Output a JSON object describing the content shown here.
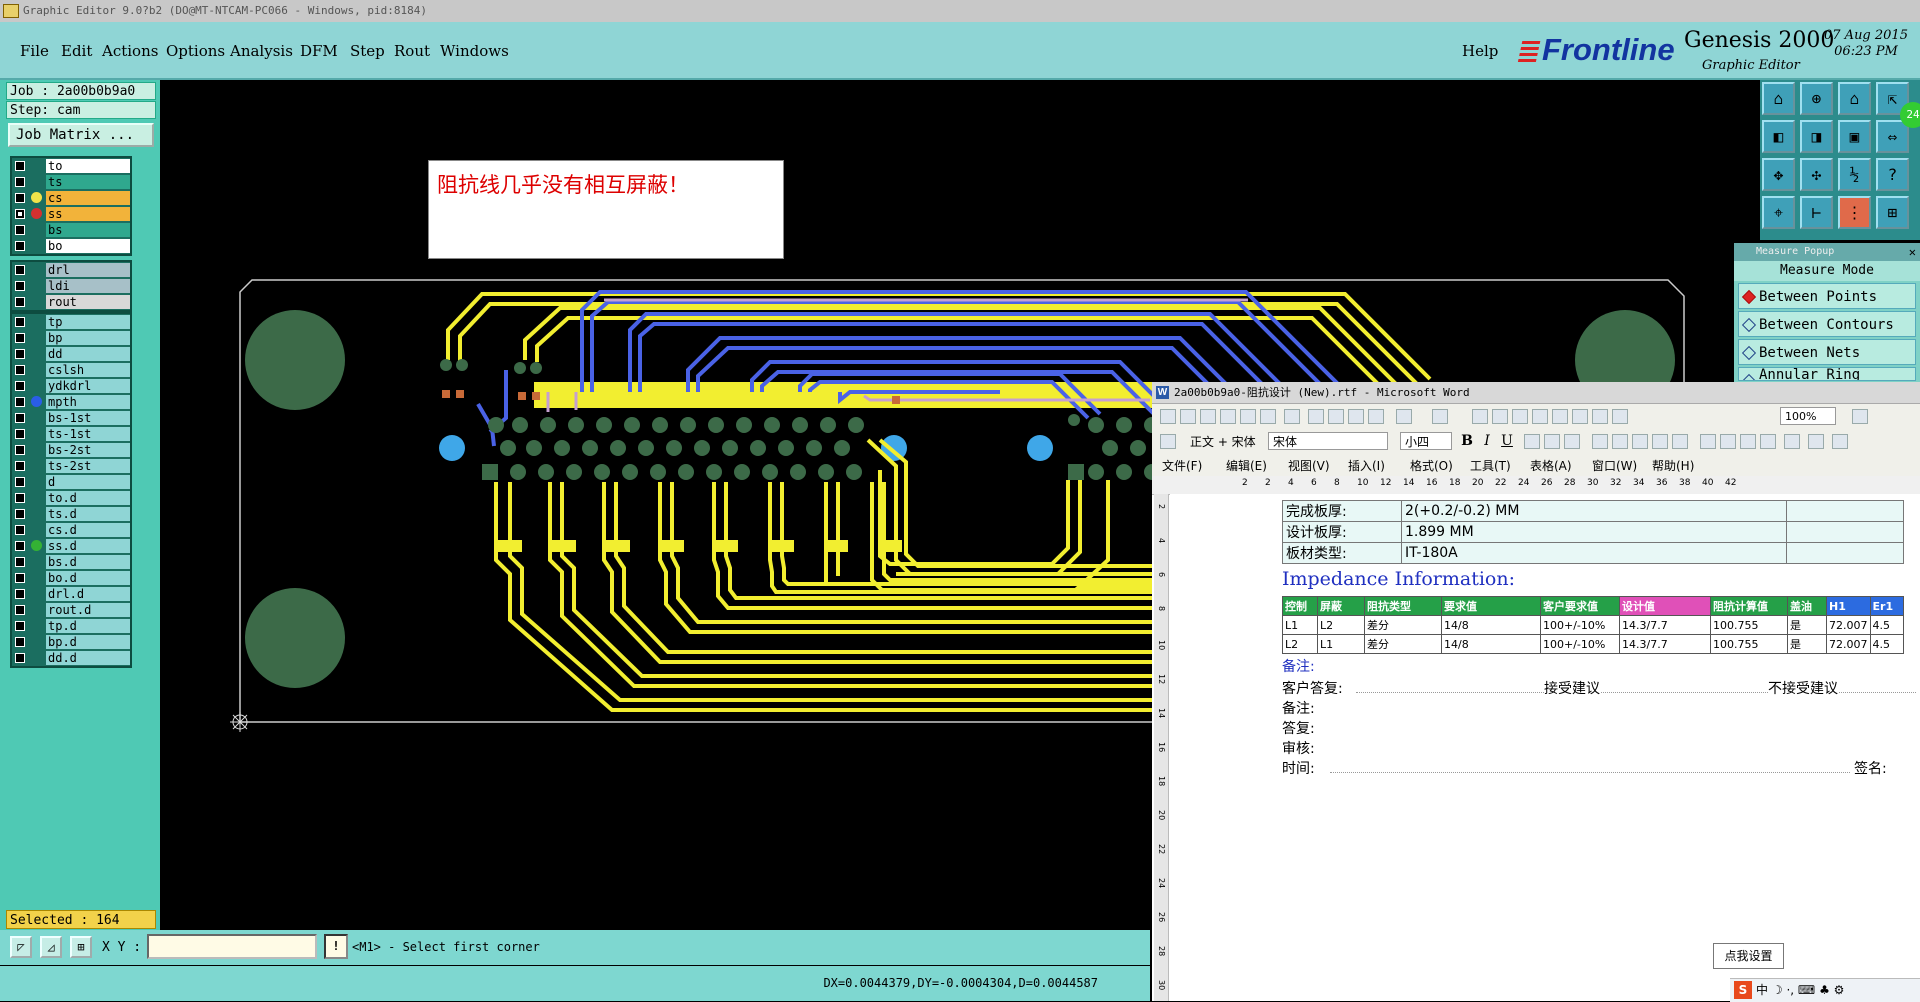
{
  "genesis": {
    "title_bar": "Graphic Editor 9.0?b2  (DO@MT-NTCAM-PC066 - Windows, pid:8184)",
    "menu": [
      "File",
      "Edit",
      "Actions",
      "Options",
      "Analysis",
      "DFM",
      "Step",
      "Rout",
      "Windows"
    ],
    "help": "Help",
    "logo": {
      "brand": "Frontline",
      "product": "Genesis 2000",
      "subtitle": "Graphic Editor",
      "date": "07 Aug 2015",
      "time": "06:23 PM"
    },
    "job": "Job : 2a00b0b9a0",
    "step": "Step: cam",
    "job_matrix": "Job Matrix ...",
    "layers_group1": [
      {
        "name": "to",
        "color": "#ffffff",
        "dot": ""
      },
      {
        "name": "ts",
        "color": "#2fa88e",
        "dot": ""
      },
      {
        "name": "cs",
        "color": "#f2b33a",
        "dot": "#f2e34a"
      },
      {
        "name": "ss",
        "color": "#f2b33a",
        "dot": "#d23030",
        "checked": true
      },
      {
        "name": "bs",
        "color": "#2fa88e",
        "dot": ""
      },
      {
        "name": "bo",
        "color": "#ffffff",
        "dot": ""
      }
    ],
    "layers_group2": [
      {
        "name": "drl",
        "color": "#a7c0c8"
      },
      {
        "name": "ldi",
        "color": "#a7c0c8"
      },
      {
        "name": "rout",
        "color": "#d8d8d8"
      }
    ],
    "layers_group3": [
      {
        "name": "tp",
        "dot": ""
      },
      {
        "name": "bp",
        "dot": ""
      },
      {
        "name": "dd",
        "dot": ""
      },
      {
        "name": "cslsh",
        "dot": ""
      },
      {
        "name": "ydkdrl",
        "dot": ""
      },
      {
        "name": "mpth",
        "dot": "#2a5de8"
      },
      {
        "name": "bs-1st",
        "dot": ""
      },
      {
        "name": "ts-1st",
        "dot": ""
      },
      {
        "name": "bs-2st",
        "dot": ""
      },
      {
        "name": "ts-2st",
        "dot": ""
      },
      {
        "name": "d",
        "dot": ""
      },
      {
        "name": "to.d",
        "dot": ""
      },
      {
        "name": "ts.d",
        "dot": ""
      },
      {
        "name": "cs.d",
        "dot": ""
      },
      {
        "name": "ss.d",
        "dot": "#34b234"
      },
      {
        "name": "bs.d",
        "dot": ""
      },
      {
        "name": "bo.d",
        "dot": ""
      },
      {
        "name": "drl.d",
        "dot": ""
      },
      {
        "name": "rout.d",
        "dot": ""
      },
      {
        "name": "tp.d",
        "dot": ""
      },
      {
        "name": "bp.d",
        "dot": ""
      },
      {
        "name": "dd.d",
        "dot": ""
      }
    ],
    "selected": "Selected : 164",
    "xy_label": "X Y :",
    "xy_value": "",
    "prompt": "<M1> - Select first corner",
    "measure_readout": "DX=0.0044379,DY=-0.0004304,D=0.0044587",
    "canvas_note": "阻抗线几乎没有相互屏蔽！",
    "measure_popup": {
      "title": "Measure Popup",
      "mode": "Measure Mode",
      "options": [
        "Between Points",
        "Between Contours",
        "Between Nets",
        "Annular Ring"
      ],
      "selected": "Between Points"
    },
    "tool_badge": "24"
  },
  "word": {
    "title": "2a00b0b9a0-阻抗设计 (New).rtf - Microsoft Word",
    "style": "正文 + 宋体",
    "font": "宋体",
    "size": "小四",
    "zoom": "100%",
    "menu": [
      "文件(F)",
      "编辑(E)",
      "视图(V)",
      "插入(I)",
      "格式(O)",
      "工具(T)",
      "表格(A)",
      "窗口(W)",
      "帮助(H)"
    ],
    "ruler": [
      "2",
      "2",
      "4",
      "6",
      "8",
      "10",
      "12",
      "14",
      "16",
      "18",
      "20",
      "22",
      "24",
      "26",
      "28",
      "30",
      "32",
      "34",
      "36",
      "38",
      "40",
      "42"
    ],
    "vruler": [
      "2",
      "4",
      "6",
      "8",
      "10",
      "12",
      "14",
      "16",
      "18",
      "20",
      "22",
      "24",
      "26",
      "28",
      "30"
    ],
    "board_rows": [
      {
        "label": "完成板厚:",
        "value": "2(+0.2/-0.2) MM"
      },
      {
        "label": "设计板厚:",
        "value": "1.899 MM"
      },
      {
        "label": "板材类型:",
        "value": "IT-180A"
      }
    ],
    "impedance_heading": "Impedance Information:",
    "imp_headers": [
      "控制",
      "屏蔽",
      "阻抗类型",
      "要求值",
      "客户要求值",
      "设计值",
      "阻抗计算值",
      "盖油",
      "H1",
      "Er1"
    ],
    "imp_rows": [
      [
        "L1",
        "L2",
        "差分",
        "14/8",
        "100+/-10%",
        "14.3/7.7",
        "100.755",
        "是",
        "72.007",
        "4.5"
      ],
      [
        "L2",
        "L1",
        "差分",
        "14/8",
        "100+/-10%",
        "14.3/7.7",
        "100.755",
        "是",
        "72.007",
        "4.5"
      ]
    ],
    "note1": "备注:",
    "customer_reply": "客户答复:",
    "accept": "接受建议",
    "reject": "不接受建议",
    "note2": "备注:",
    "reply": "答复:",
    "review": "审核:",
    "time": "时间:",
    "sign": "签名:"
  },
  "taskbar": {
    "tooltip": "点我设置",
    "ime": "中"
  },
  "colors": {
    "genesis_bg": "#8fd5d5",
    "pcb_yellow": "#f2ee30",
    "pcb_blue": "#4a62e6",
    "pad_green": "#3c6a48"
  }
}
